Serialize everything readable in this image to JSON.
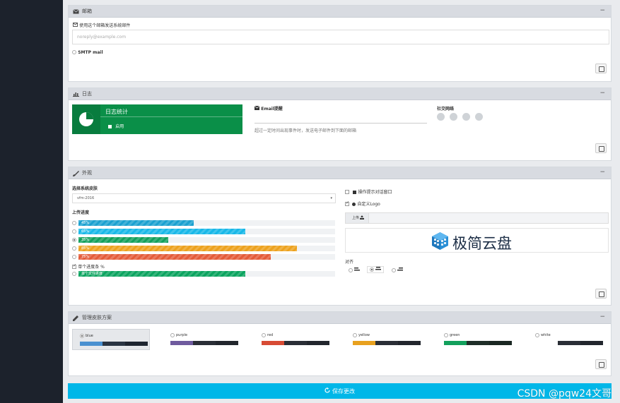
{
  "email_panel": {
    "title": "邮箱",
    "use_email_label": "使用这个邮箱发送系统邮件",
    "email_placeholder": "noreply@example.com",
    "smtp_label": "SMTP mail"
  },
  "log_panel": {
    "title": "日志",
    "stats_title": "日志统计",
    "stats_enabled": "启用",
    "email_notify_label": "Email提醒",
    "email_notify_hint": "超过一定时间出现事件时，发送电子邮件到下面的邮箱",
    "social_title": "社交网络"
  },
  "appearance_panel": {
    "title": "外观",
    "theme_label": "选择系统皮肤",
    "theme_value": "vfm-2016",
    "progress_label": "上传进度",
    "bars": [
      {
        "label": "45%",
        "value": 45,
        "color": "#1ba1d0",
        "selected": false
      },
      {
        "label": "65%",
        "value": 65,
        "color": "#19b8e8",
        "selected": false
      },
      {
        "label": "35%",
        "value": 35,
        "color": "#12a05c",
        "selected": true
      },
      {
        "label": "85%",
        "value": 85,
        "color": "#eda21e",
        "selected": false
      },
      {
        "label": "75%",
        "value": 75,
        "color": "#e45c3a",
        "selected": false
      }
    ],
    "single_progress_label": "单个进度条 %",
    "single_progress_bar": {
      "label": "单个文件进度",
      "value": 65,
      "color": "#0ba45f"
    },
    "show_tips_label": "操作提示对话窗口",
    "custom_logo_label": "自定义Logo",
    "upload_button": "上传",
    "logo_text": "极简云盘",
    "align_label": "对齐"
  },
  "skin_panel": {
    "title": "管理皮肤方案",
    "skins": [
      {
        "name": "blue",
        "selected": true,
        "colors": [
          "#4a90d0",
          "#2a3442",
          "#1e2530"
        ]
      },
      {
        "name": "purple",
        "selected": false,
        "colors": [
          "#6f5b9e",
          "#2a2e36",
          "#22262d"
        ]
      },
      {
        "name": "red",
        "selected": false,
        "colors": [
          "#d74b34",
          "#2a2e36",
          "#22262d"
        ]
      },
      {
        "name": "yellow",
        "selected": false,
        "colors": [
          "#e8a11f",
          "#2a2e36",
          "#22262d"
        ]
      },
      {
        "name": "green",
        "selected": false,
        "colors": [
          "#12a05c",
          "#1f2e28",
          "#1a2722"
        ]
      },
      {
        "name": "white",
        "selected": false,
        "colors": [
          "#ffffff",
          "#2a2e36",
          "#22262d"
        ]
      }
    ]
  },
  "save_all_label": "保存更改",
  "watermark": "CSDN @pqw24文哥"
}
